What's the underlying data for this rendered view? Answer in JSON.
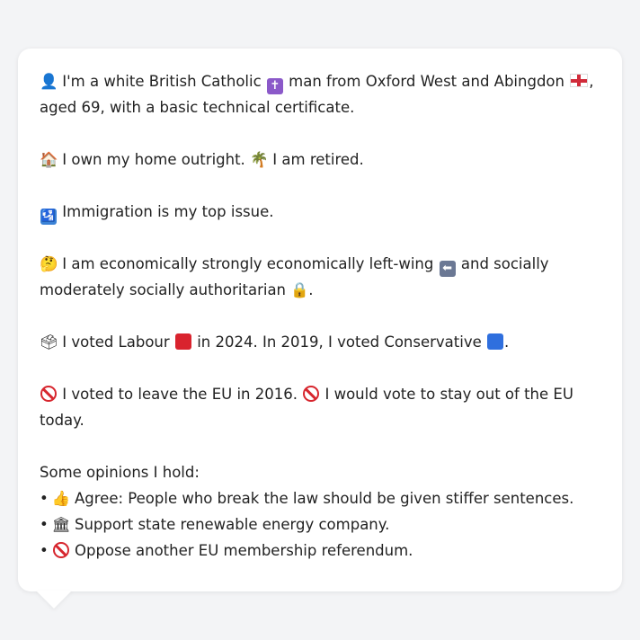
{
  "profile": {
    "intro_line": "I'm a white British Catholic",
    "intro_mid": "man from Oxford West and Abingdon",
    "intro_end": ", aged 69, with a basic technical certificate.",
    "home": "I own my home outright.",
    "retired": "I am retired.",
    "top_issue": "Immigration is my top issue.",
    "econ_a": "I am economically strongly economically left-wing",
    "econ_b": "and socially moderately socially authoritarian",
    "econ_end": ".",
    "vote_a": "I voted Labour",
    "vote_b": "in 2024. In 2019, I voted Conservative",
    "vote_end": ".",
    "eu_a": "I voted to leave the EU in 2016.",
    "eu_b": "I would vote to stay out of the EU today.",
    "opinions_heading": "Some opinions I hold:",
    "opinions": [
      "Agree: People who break the law should be given stiffer sentences.",
      "Support state renewable energy company.",
      "Oppose another EU membership referendum."
    ],
    "bullet": "•"
  },
  "icons": {
    "person": "👤",
    "cross": "✝",
    "house": "🏠",
    "palm": "🌴",
    "immigration": "🛂",
    "thinking": "🤔",
    "left_arrow": "⬅",
    "lock": "🔒",
    "ballot": "🗳",
    "thumbs_up": "👍",
    "building": "🏛"
  },
  "colors": {
    "labour": "#d9232e",
    "conservative": "#2f6fde",
    "ban": "#d7262e"
  }
}
